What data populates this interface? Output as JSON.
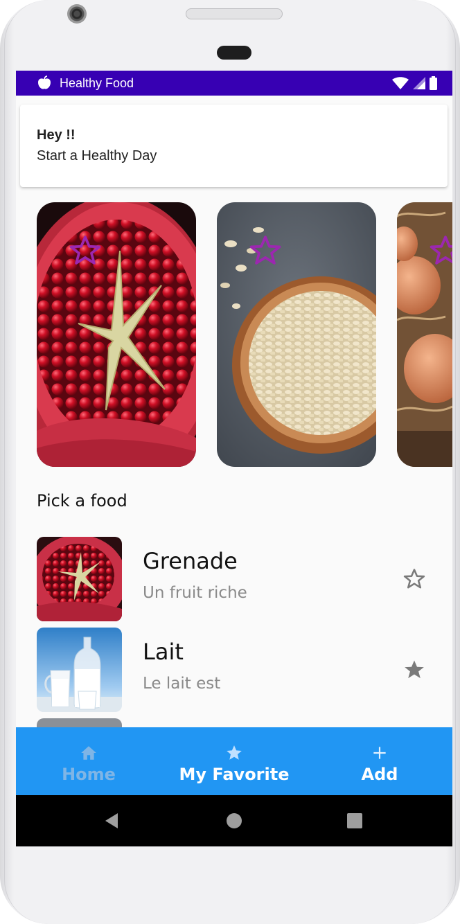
{
  "status_bar": {
    "app_title": "Healthy Food",
    "background": "#3700b3",
    "icons": [
      "apple-icon",
      "wifi-icon",
      "signal-icon",
      "battery-icon"
    ]
  },
  "header": {
    "greeting": "Hey !!",
    "subtitle": "Start a Healthy Day"
  },
  "carousel": {
    "cards": [
      {
        "subject": "pomegranate",
        "icon": "star-outline-icon"
      },
      {
        "subject": "oats-bowl",
        "icon": "star-outline-icon"
      },
      {
        "subject": "eggs",
        "icon": "star-outline-icon"
      }
    ],
    "star_color": "#9c27b0"
  },
  "section": {
    "title": "Pick a food"
  },
  "food_list": [
    {
      "name": "Grenade",
      "description": "Un fruit riche",
      "favorite": false,
      "icon": "star-outline-icon"
    },
    {
      "name": "Lait",
      "description": "Le lait est",
      "favorite": true,
      "icon": "star-filled-icon"
    }
  ],
  "bottom_nav": {
    "background": "#2196f3",
    "items": [
      {
        "label": "Home",
        "icon": "home-icon",
        "color": "#7fb5e6"
      },
      {
        "label": "My Favorite",
        "icon": "star-icon",
        "color": "#ffffff"
      },
      {
        "label": "Add",
        "icon": "plus-icon",
        "color": "#ffffff"
      }
    ]
  },
  "system_nav": {
    "buttons": [
      "back-icon",
      "home-circle-icon",
      "recents-icon"
    ]
  }
}
